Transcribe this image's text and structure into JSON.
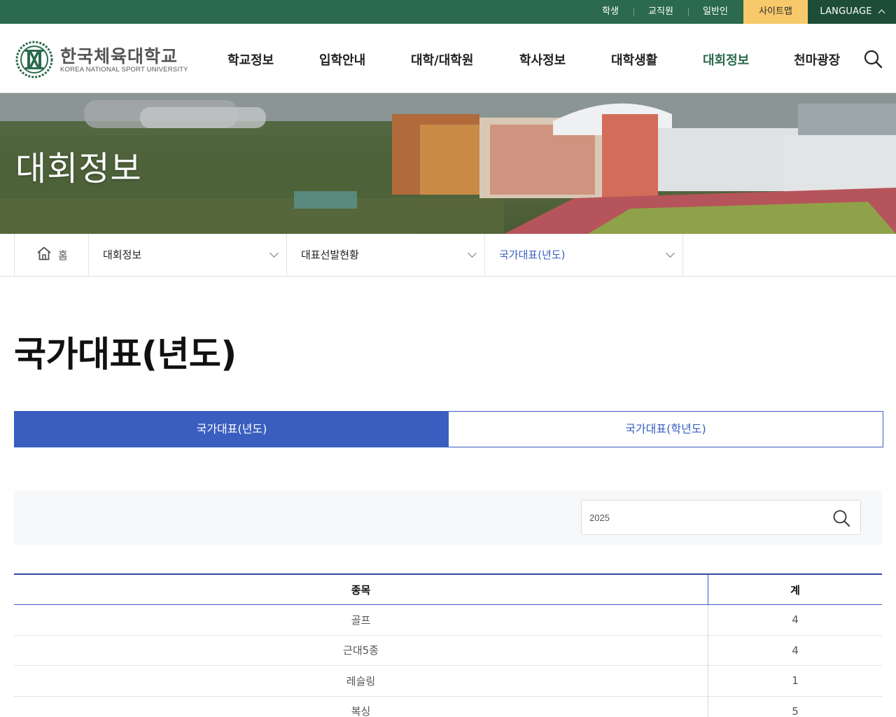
{
  "topbar": {
    "links": [
      "학생",
      "교직원",
      "일반인"
    ],
    "sitemap_label": "사이트맵",
    "language_label": "LANGUAGE"
  },
  "header": {
    "logo_ko": "한국체육대학교",
    "logo_en": "KOREA NATIONAL SPORT UNIVERSITY",
    "nav": [
      "학교정보",
      "입학안내",
      "대학/대학원",
      "학사정보",
      "대학생활",
      "대회정보",
      "천마광장"
    ],
    "active_nav_index": 5
  },
  "hero": {
    "title": "대회정보"
  },
  "breadcrumb": {
    "home_label": "홈",
    "level1": "대회정보",
    "level2": "대표선발현황",
    "level3": "국가대표(년도)"
  },
  "page": {
    "title": "국가대표(년도)"
  },
  "tabs": [
    {
      "label": "국가대표(년도)",
      "active": true
    },
    {
      "label": "국가대표(학년도)",
      "active": false
    }
  ],
  "search": {
    "value": "2025"
  },
  "table": {
    "headers": [
      "종목",
      "계"
    ],
    "rows": [
      {
        "sport": "골프",
        "total": "4"
      },
      {
        "sport": "근대5종",
        "total": "4"
      },
      {
        "sport": "레슬링",
        "total": "1"
      },
      {
        "sport": "복싱",
        "total": "5"
      }
    ]
  },
  "colors": {
    "brand_green": "#2b6a4c",
    "sitemap_yellow": "#f7c96a",
    "accent_blue": "#3a5ec0"
  }
}
